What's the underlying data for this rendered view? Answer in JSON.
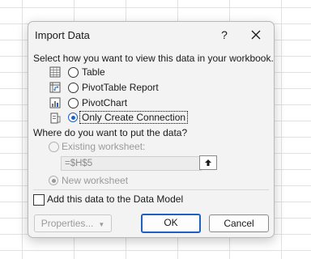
{
  "dialog": {
    "title": "Import Data",
    "help_label": "?",
    "prompt_view": "Select how you want to view this data in your workbook.",
    "view_options": [
      {
        "label": "Table",
        "selected": false,
        "icon": "table-icon"
      },
      {
        "label": "PivotTable Report",
        "selected": false,
        "icon": "pivottable-icon"
      },
      {
        "label": "PivotChart",
        "selected": false,
        "icon": "pivotchart-icon"
      },
      {
        "label": "Only Create Connection",
        "selected": true,
        "icon": "connection-icon"
      }
    ],
    "prompt_location": "Where do you want to put the data?",
    "location_options": [
      {
        "label": "Existing worksheet:",
        "selected": false,
        "enabled": false
      },
      {
        "label": "New worksheet",
        "selected": true,
        "enabled": false
      }
    ],
    "cell_reference": "=$H$5",
    "data_model_label": "Add this data to the Data Model",
    "data_model_checked": false,
    "buttons": {
      "properties": "Properties...",
      "ok": "OK",
      "cancel": "Cancel"
    },
    "accent_color": "#1f5fbf"
  }
}
